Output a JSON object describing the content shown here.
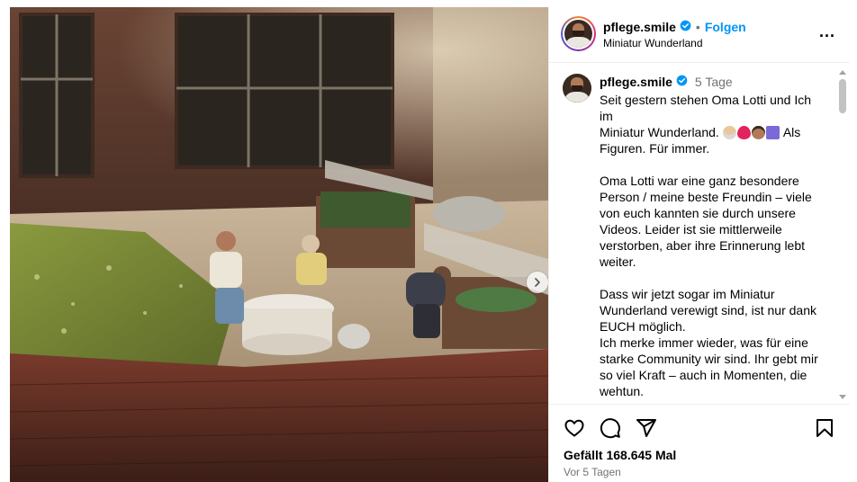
{
  "post": {
    "username": "pflege.smile",
    "follow_label": "Folgen",
    "dot": "•",
    "location": "Miniatur Wunderland",
    "more_label": "..."
  },
  "caption": {
    "username": "pflege.smile",
    "age": "5 Tage",
    "lines": [
      "Seit gestern stehen Oma Lotti und Ich",
      "im",
      "Miniatur Wunderland.",
      "Als",
      "Figuren. Für immer.",
      "Oma Lotti war eine ganz besondere",
      "Person / meine beste Freundin – viele",
      "von euch kannten sie durch unsere",
      "Videos. Leider ist sie mittlerweile",
      "verstorben, aber ihre Erinnerung lebt",
      "weiter.",
      "Dass wir jetzt sogar im Miniatur",
      "Wunderland verewigt sind, ist nur dank",
      "EUCH möglich.",
      "Ich merke immer wieder, was für eine",
      "starke Community wir sind. Ihr gebt mir",
      "so viel Kraft – auch in Momenten, die",
      "wehtun."
    ],
    "emojis": [
      "older-woman-emoji",
      "red-heart-emoji",
      "man-emoji",
      "medical-emoji"
    ]
  },
  "engagement": {
    "likes": "Gefällt 168.645 Mal",
    "posted": "Vor 5 Tagen"
  },
  "icons": {
    "like": "heart-icon",
    "comment": "comment-icon",
    "share": "send-icon",
    "save": "bookmark-icon",
    "next": "chevron-right-icon",
    "verified": "verified-badge-icon"
  },
  "colors": {
    "accent": "#0095f6",
    "verified": "#0095f6",
    "secondary_text": "#737373",
    "divider": "#efefef"
  }
}
